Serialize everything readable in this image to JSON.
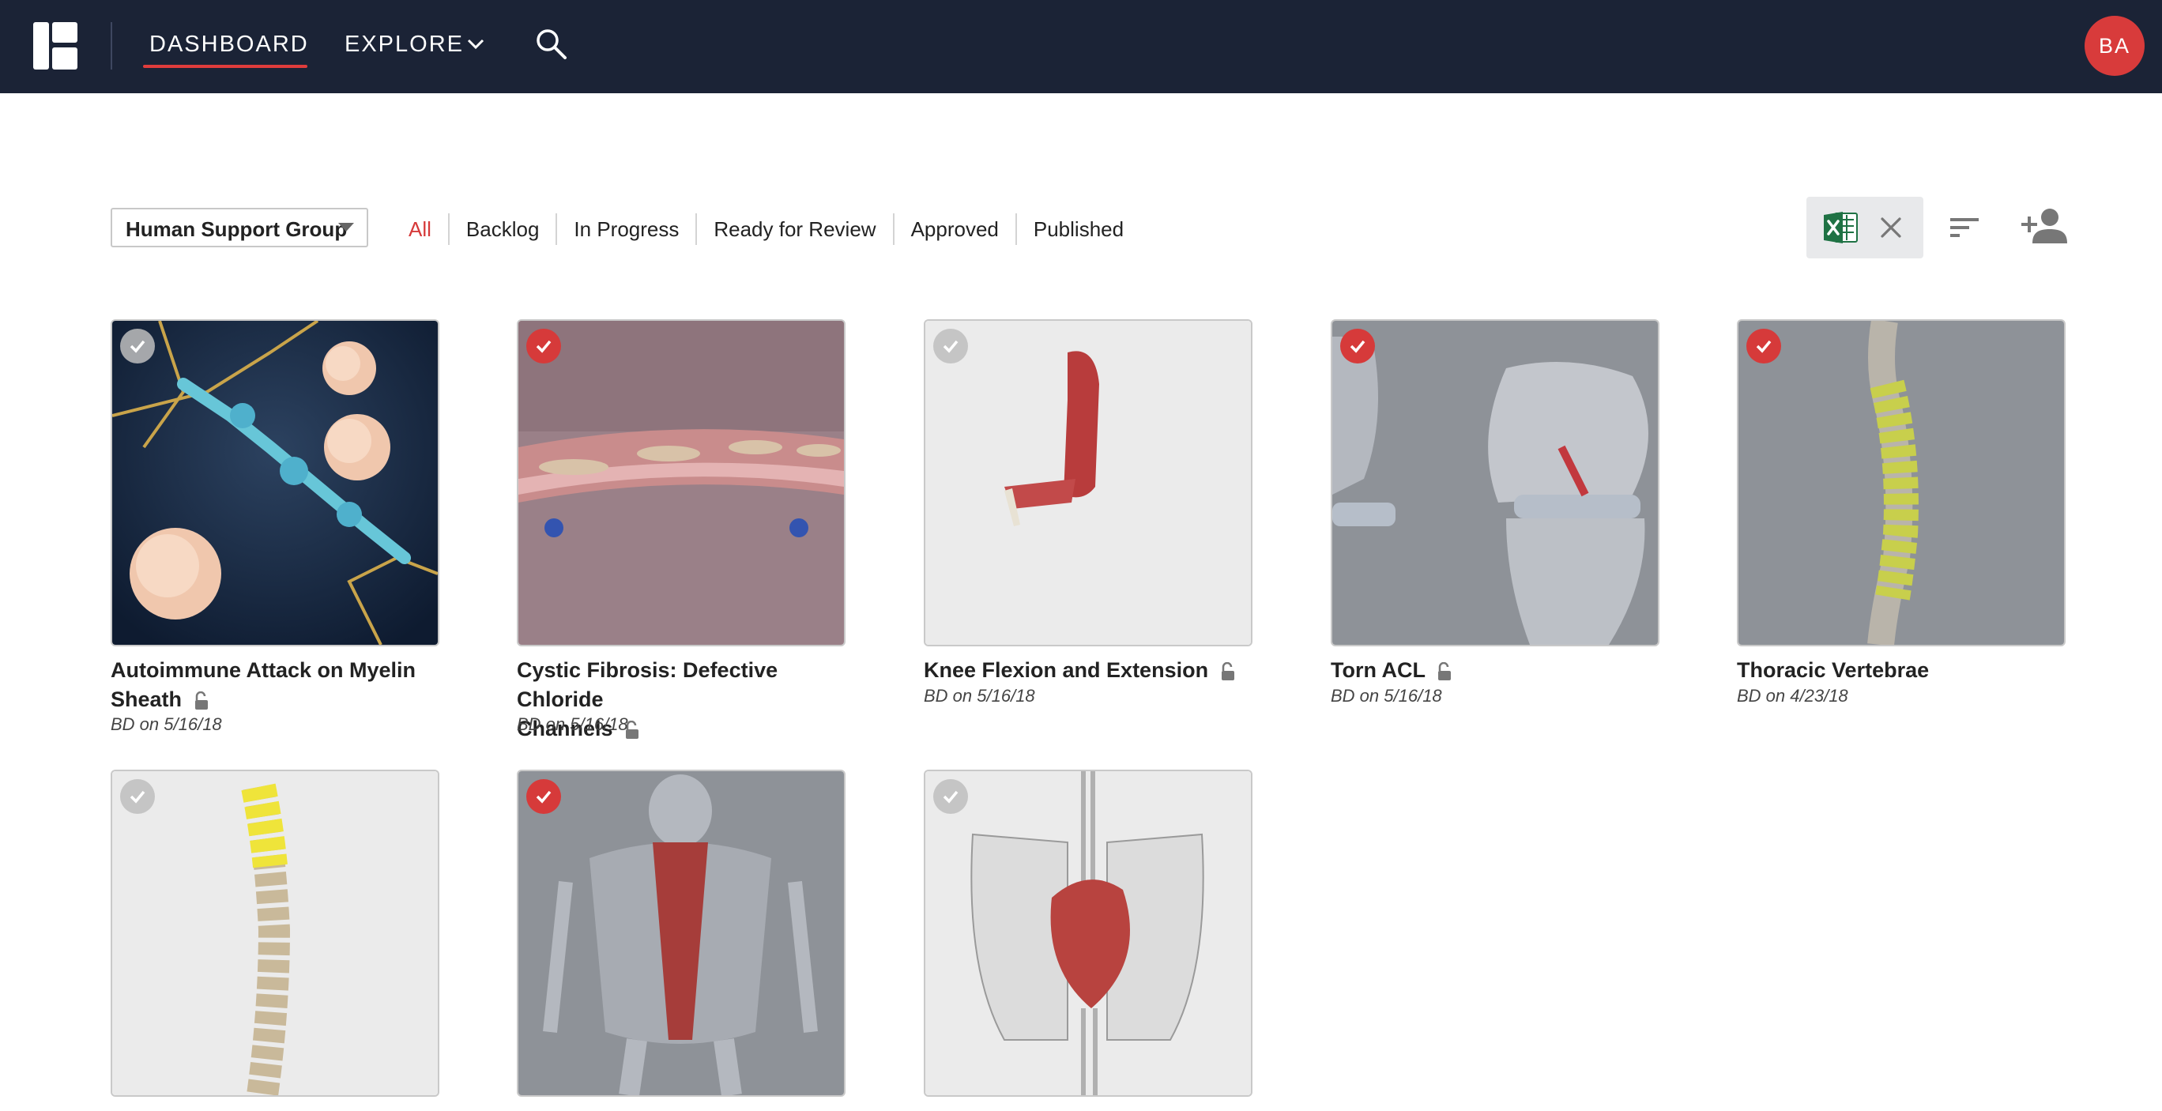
{
  "nav": {
    "dashboard_label": "DASHBOARD",
    "explore_label": "EXPLORE",
    "avatar_initials": "BA"
  },
  "filters": {
    "group_select_value": "Human Support Group",
    "tabs": [
      {
        "label": "All",
        "active": true
      },
      {
        "label": "Backlog",
        "active": false
      },
      {
        "label": "In Progress",
        "active": false
      },
      {
        "label": "Ready for Review",
        "active": false
      },
      {
        "label": "Approved",
        "active": false
      },
      {
        "label": "Published",
        "active": false
      }
    ]
  },
  "cards": [
    {
      "title_line1": "Autoimmune Attack on Myelin",
      "title_line2": "Sheath",
      "meta": "BD on 5/16/18",
      "checked": false,
      "locked": true
    },
    {
      "title_line1": "Cystic Fibrosis: Defective Chloride",
      "title_line2": "Channels",
      "meta": "BD on 5/16/18",
      "checked": true,
      "locked": true
    },
    {
      "title_line1": "Knee Flexion and Extension",
      "meta": "BD on 5/16/18",
      "checked": false,
      "locked": true
    },
    {
      "title_line1": "Torn ACL",
      "meta": "BD on 5/16/18",
      "checked": true,
      "locked": true
    },
    {
      "title_line1": "Thoracic Vertebrae",
      "meta": "BD on 4/23/18",
      "checked": true,
      "locked": false
    },
    {
      "checked": false
    },
    {
      "checked": true
    },
    {
      "checked": false
    }
  ],
  "colors": {
    "nav_bg": "#1b2336",
    "accent_red": "#d63a3a",
    "excel_green": "#1f7244"
  }
}
